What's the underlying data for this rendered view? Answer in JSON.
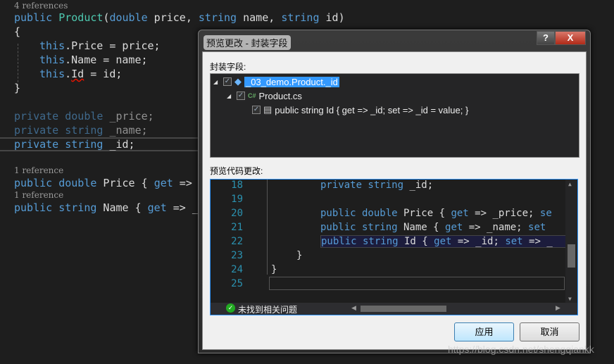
{
  "editor": {
    "refs": [
      "4 references",
      "1 reference",
      "1 reference"
    ],
    "lines": {
      "ctor": [
        "public",
        "Product",
        "(",
        "double",
        " price, ",
        "string",
        " name, ",
        "string",
        " id)"
      ],
      "open": "{",
      "a1": [
        "this",
        ".Price = price;"
      ],
      "a2": [
        "this",
        ".Name = name;"
      ],
      "a3": [
        "this",
        ".",
        "Id",
        " = id;"
      ],
      "close": "}",
      "f1": [
        "private",
        "double",
        "_price;"
      ],
      "f2": [
        "private",
        "string",
        "_name;"
      ],
      "f3": [
        "private",
        "string",
        "_id;"
      ],
      "p1": [
        "public",
        "double",
        " Price { ",
        "get",
        " =>"
      ],
      "p2": [
        "public",
        "string",
        " Name { ",
        "get",
        " => _"
      ]
    }
  },
  "dialog": {
    "title": "预览更改 - 封装字段",
    "help": "?",
    "close": "X",
    "tree_label": "封装字段:",
    "tree": [
      "_03_demo.Product._id",
      "Product.cs",
      "public string Id { get => _id; set => _id = value; }"
    ],
    "cs_icon": "C#",
    "preview_label": "预览代码更改:",
    "line_numbers": [
      "18",
      "19",
      "20",
      "21",
      "22",
      "23",
      "24",
      "25"
    ],
    "code": {
      "l18": [
        "private string",
        " _id;"
      ],
      "l20": [
        "public double",
        " Price { ",
        "get",
        " => _price; ",
        "se"
      ],
      "l21": [
        "public string",
        " Name { ",
        "get",
        " => _name; ",
        "set"
      ],
      "l22": [
        "public string",
        " Id { ",
        "get",
        " => _id; ",
        "set",
        " => _"
      ],
      "l23": "}",
      "l24": "}"
    },
    "status": "未找到相关问题",
    "apply": "应用",
    "cancel": "取消"
  },
  "watermark": "https://blog.csdn.net/shengqiankk"
}
